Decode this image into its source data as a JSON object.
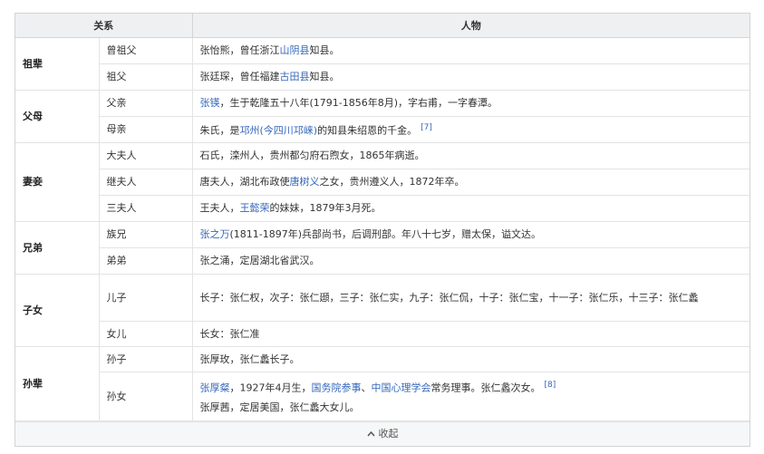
{
  "header": {
    "relation": "关系",
    "person": "人物"
  },
  "groups": {
    "zubei": "祖辈",
    "fumu": "父母",
    "qiqie": "妻妾",
    "xiongdi": "兄弟",
    "zinv": "子女",
    "sunbei": "孙辈"
  },
  "rows": {
    "r0": {
      "rel": "曾祖父",
      "t0": "张怡熊，曾任浙江",
      "l0": "山阴县",
      "t1": "知县。"
    },
    "r1": {
      "rel": "祖父",
      "t0": "张廷琛，曾任福建",
      "l0": "古田县",
      "t1": "知县。"
    },
    "r2": {
      "rel": "父亲",
      "l0": "张锳",
      "t0": "，生于乾隆五十八年(1791-1856年8月)，字右甫，一字春潭。"
    },
    "r3": {
      "rel": "母亲",
      "t0": "朱氏，是",
      "l0": "邛州(今四川邛崃)",
      "t1": "的知县朱绍恩的千金。",
      "ref": "[7]"
    },
    "r4": {
      "rel": "大夫人",
      "t0": "石氏，滦州人，贵州都匀府石煦女，1865年病逝。"
    },
    "r5": {
      "rel": "继夫人",
      "t0": "唐夫人，湖北布政使",
      "l0": "唐树义",
      "t1": "之女，贵州遵义人，1872年卒。"
    },
    "r6": {
      "rel": "三夫人",
      "t0": "王夫人，",
      "l0": "王懿荣",
      "t1": "的妹妹，1879年3月死。"
    },
    "r7": {
      "rel": "族兄",
      "l0": "张之万",
      "t0": "(1811-1897年)兵部尚书，后调刑部。年八十七岁，赠太保，谥文达。"
    },
    "r8": {
      "rel": "弟弟",
      "t0": "张之涌，定居湖北省武汉。"
    },
    "r9": {
      "rel": "儿子",
      "t0": "长子：张仁权，次子：张仁頲，三子：张仁实，九子：张仁侃，十子：张仁宝，十一子：张仁乐，十三子：张仁蠡"
    },
    "r10": {
      "rel": "女儿",
      "t0": "长女：张仁准"
    },
    "r11": {
      "rel": "孙子",
      "t0": "张厚玫，张仁蠡长子。"
    },
    "r12": {
      "rel": "孙女",
      "l0": "张厚粲",
      "t0": "，1927年4月生，",
      "l1": "国务院参事",
      "t1": "、",
      "l2": "中国心理学会",
      "t2": "常务理事。张仁蠡次女。",
      "ref": "[8]",
      "t3": "张厚茜，定居美国，张仁蠡大女儿。"
    }
  },
  "footer": {
    "collapse": "收起",
    "icon": "chevron-up-icon"
  },
  "colors": {
    "link": "#3366bb",
    "header_bg": "#eef0f2",
    "border": "#d4d4d4"
  }
}
